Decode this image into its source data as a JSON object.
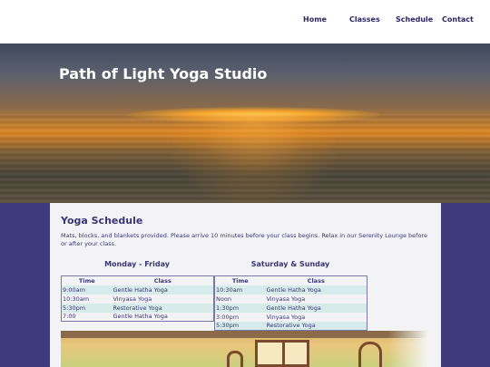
{
  "nav": {
    "home": "Home",
    "classes": "Classes",
    "schedule": "Schedule",
    "contact": "Contact"
  },
  "hero": {
    "title": "Path of Light Yoga Studio"
  },
  "schedule": {
    "heading": "Yoga Schedule",
    "intro": "Mats, blocks, and blankets provided. Please arrive 10 minutes before your class begins. Relax in our Serenity Lounge before or after your class.",
    "weekday": {
      "title": "Monday - Friday",
      "col_time": "Time",
      "col_class": "Class",
      "rows": [
        {
          "time": "9:00am",
          "class": "Gentle Hatha Yoga"
        },
        {
          "time": "10:30am",
          "class": "Vinyasa Yoga"
        },
        {
          "time": "5:30pm",
          "class": "Restorative Yoga"
        },
        {
          "time": "7:00",
          "class": "Gentle Hatha Yoga"
        }
      ]
    },
    "weekend": {
      "title": "Saturday & Sunday",
      "col_time": "Time",
      "col_class": "Class",
      "rows": [
        {
          "time": "10:30am",
          "class": "Gentle Hatha Yoga"
        },
        {
          "time": "Noon",
          "class": "Vinyasa Yoga"
        },
        {
          "time": "1:30pm",
          "class": "Gentle Hatha Yoga"
        },
        {
          "time": "3:00pm",
          "class": "Vinyasa Yoga"
        },
        {
          "time": "5:30pm",
          "class": "Restorative Yoga"
        }
      ]
    }
  },
  "colors": {
    "page_background": "#3f3a7c",
    "text_purple": "#3a3575",
    "row_highlight": "#d6ebea"
  }
}
